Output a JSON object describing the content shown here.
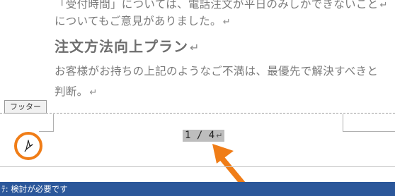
{
  "document": {
    "line1": "「受付時間」については、電話注文が平日のみしかできないこと",
    "line2": "についてもご意見がありました。",
    "heading": "注文方法向上プラン",
    "line3": "お客様がお持ちの上記のようなご不満は、最優先で解決すべきと",
    "line4": "判断。",
    "paragraph_mark": "↵"
  },
  "footer": {
    "tab_label": "フッター",
    "page_number": "1 / 4"
  },
  "status_bar": {
    "text": "ﾃ: 検討が必要です"
  },
  "colors": {
    "highlight": "#f07d17",
    "status_bar": "#2b579a"
  }
}
